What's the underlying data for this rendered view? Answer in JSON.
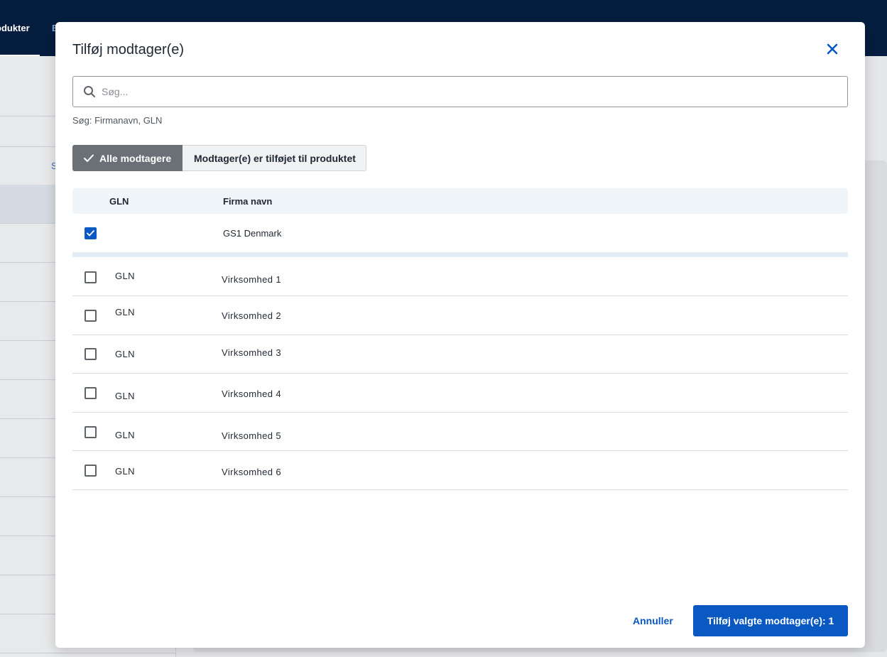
{
  "nav": {
    "active_label": "odukter",
    "next_label": "B"
  },
  "background": {
    "link_label": "S"
  },
  "modal": {
    "title": "Tilføj modtager(e)",
    "search": {
      "placeholder": "Søg...",
      "hint": "Søg: Firmanavn, GLN"
    },
    "filters": {
      "all_label": "Alle modtagere",
      "added_label": "Modtager(e) er tilføjet til produktet",
      "active": "all"
    },
    "table": {
      "headers": {
        "gln": "GLN",
        "company": "Firma navn"
      },
      "selected": [
        {
          "gln": "",
          "company": "GS1 Denmark",
          "checked": true
        }
      ],
      "rows": [
        {
          "gln": "GLN",
          "company": "Virksomhed 1",
          "checked": false
        },
        {
          "gln": "GLN",
          "company": "Virksomhed 2",
          "checked": false
        },
        {
          "gln": "GLN",
          "company": "Virksomhed 3",
          "checked": false
        },
        {
          "gln": "GLN",
          "company": "Virksomhed 4",
          "checked": false
        },
        {
          "gln": "GLN",
          "company": "Virksomhed 5",
          "checked": false
        },
        {
          "gln": "GLN",
          "company": "Virksomhed 6",
          "checked": false
        }
      ]
    },
    "footer": {
      "cancel_label": "Annuller",
      "submit_label": "Tilføj valgte modtager(e): 1"
    }
  },
  "colors": {
    "primary": "#0a58c2",
    "topbar": "#051d3f",
    "segment_active": "#6b7077"
  },
  "icons": {
    "close": "close-icon",
    "search": "search-icon",
    "check": "checkmark-icon"
  }
}
